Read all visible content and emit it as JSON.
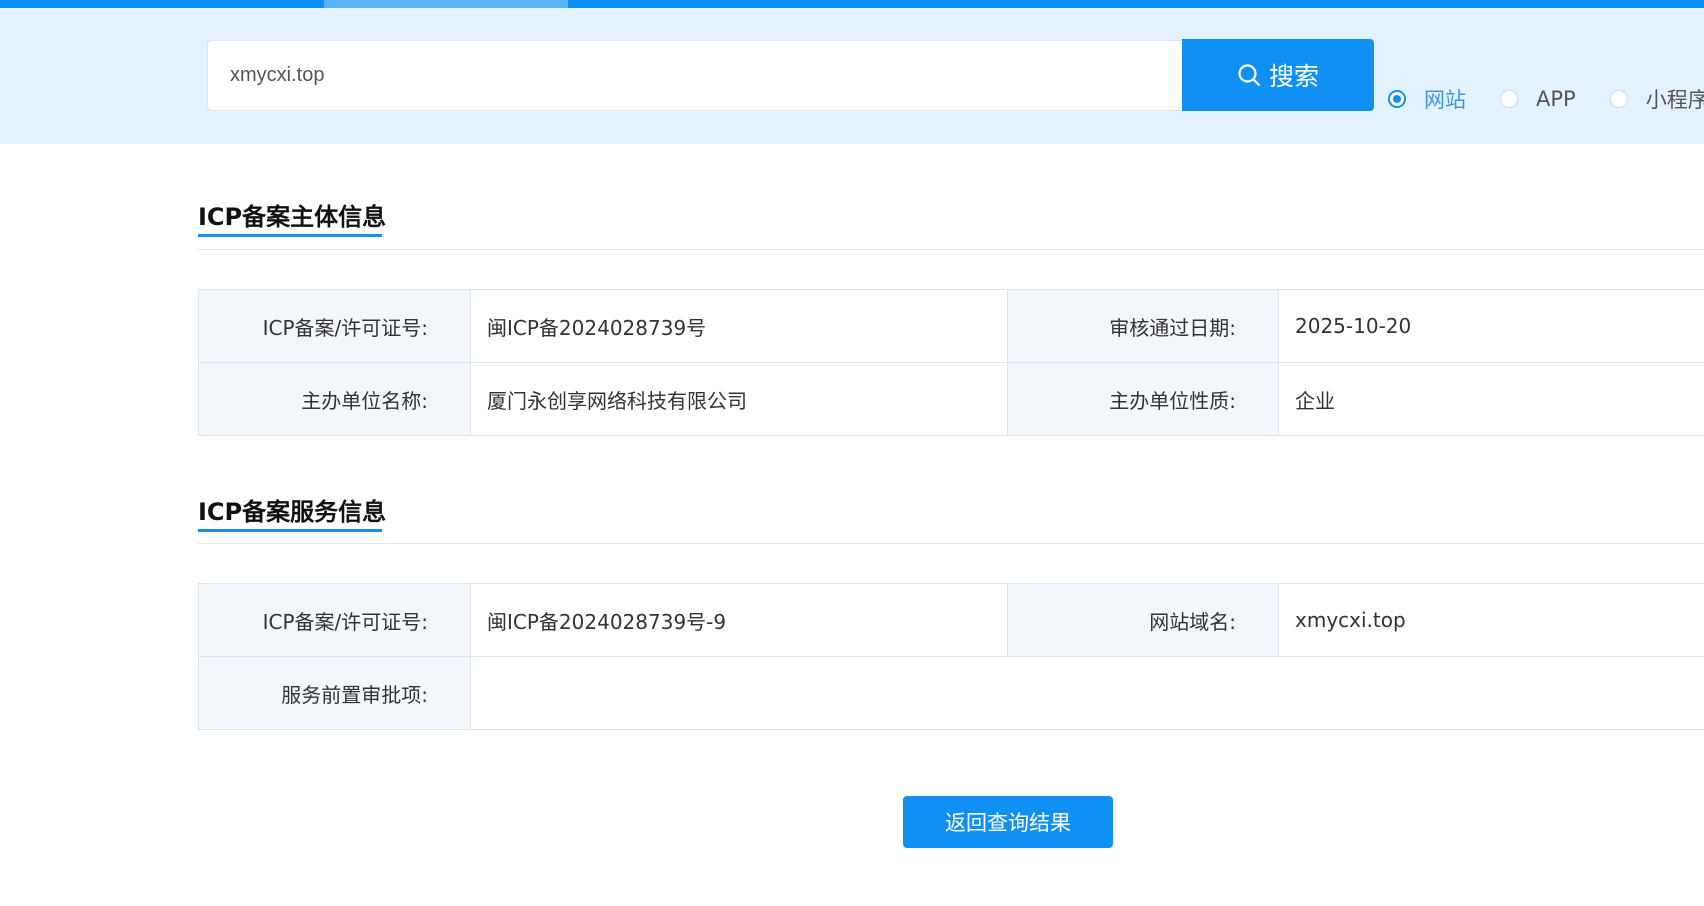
{
  "search": {
    "value": "xmycxi.top",
    "button_label": "搜索"
  },
  "types": [
    {
      "label": "网站",
      "checked": true
    },
    {
      "label": "APP",
      "checked": false
    },
    {
      "label": "小程序",
      "checked": false
    }
  ],
  "subject": {
    "title": "ICP备案主体信息",
    "license_label": "ICP备案/许可证号:",
    "license_value": "闽ICP备2024028739号",
    "approve_date_label": "审核通过日期:",
    "approve_date_value": "2025-10-20",
    "org_name_label": "主办单位名称:",
    "org_name_value": "厦门永创享网络科技有限公司",
    "org_type_label": "主办单位性质:",
    "org_type_value": "企业"
  },
  "service": {
    "title": "ICP备案服务信息",
    "license_label": "ICP备案/许可证号:",
    "license_value": "闽ICP备2024028739号-9",
    "domain_label": "网站域名:",
    "domain_value": "xmycxi.top",
    "preapproval_label": "服务前置审批项:",
    "preapproval_value": ""
  },
  "back_button": "返回查询结果",
  "colors": {
    "accent": "#1090f3",
    "band": "#e3f2fe",
    "label_bg": "#f3f7fb"
  }
}
